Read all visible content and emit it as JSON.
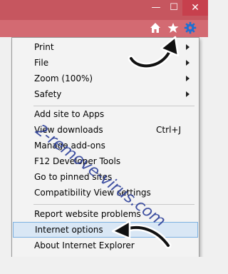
{
  "window": {
    "minimize_glyph": "—",
    "maximize_glyph": "☐",
    "close_glyph": "✕",
    "title_color": "#c6565f"
  },
  "toolbar": {
    "icons": [
      "home-icon",
      "star-icon",
      "gear-icon"
    ]
  },
  "menu": {
    "items": [
      {
        "label": "Print",
        "submenu": true
      },
      {
        "label": "File",
        "submenu": true
      },
      {
        "label": "Zoom (100%)",
        "submenu": true
      },
      {
        "label": "Safety",
        "submenu": true
      },
      {
        "label": "Add site to Apps"
      },
      {
        "label": "View downloads",
        "shortcut": "Ctrl+J"
      },
      {
        "label": "Manage add-ons"
      },
      {
        "label": "F12 Developer Tools"
      },
      {
        "label": "Go to pinned sites"
      },
      {
        "label": "Compatibility View settings"
      },
      {
        "label": "Report website problems"
      },
      {
        "label": "Internet options",
        "highlighted": true
      },
      {
        "label": "About Internet Explorer"
      }
    ]
  },
  "watermark": "2-remove-virus.com"
}
